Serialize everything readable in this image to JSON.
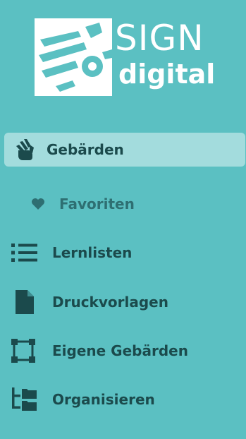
{
  "logo": {
    "word_sign": "SIGN",
    "word_digital": "digital"
  },
  "nav": {
    "items": [
      {
        "label": "Gebärden",
        "icon": "signing-hands-icon",
        "active": true
      },
      {
        "label": "Favoriten",
        "icon": "heart-icon",
        "sub": true
      },
      {
        "label": "Lernlisten",
        "icon": "list-icon"
      },
      {
        "label": "Druckvorlagen",
        "icon": "file-icon"
      },
      {
        "label": "Eigene Gebärden",
        "icon": "vector-square-icon"
      },
      {
        "label": "Organisieren",
        "icon": "folder-tree-icon"
      }
    ]
  },
  "colors": {
    "sidebar_bg": "#5bc0c2",
    "active_bg": "#a3dcdd",
    "text": "#1b4a4c",
    "sub_text": "#2e6f72",
    "logo": "#ffffff"
  }
}
